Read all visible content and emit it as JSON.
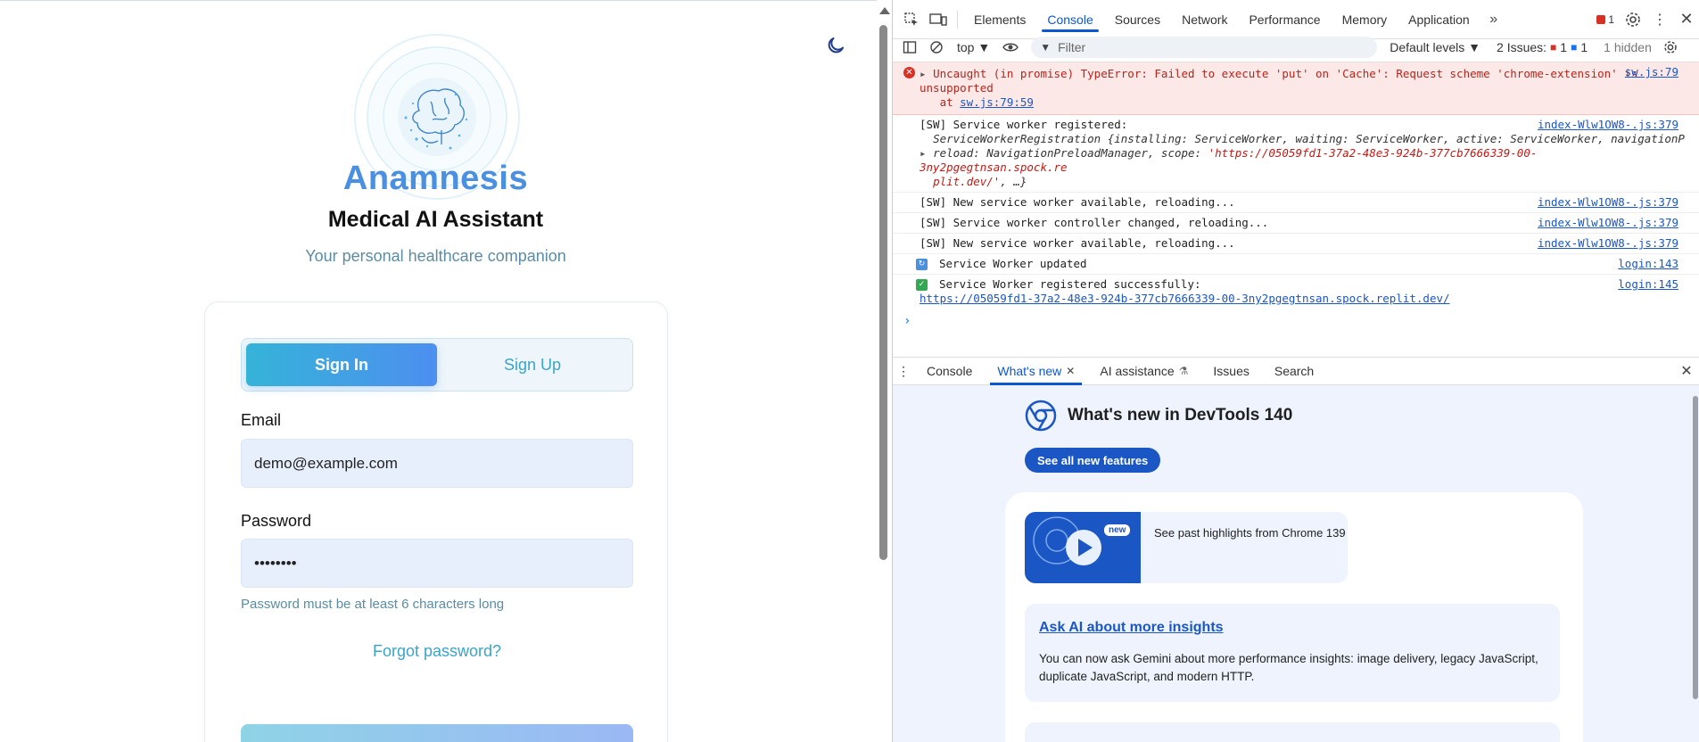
{
  "app": {
    "brand": "Anamnesis",
    "subtitle": "Medical AI Assistant",
    "tagline": "Your personal healthcare companion",
    "tabs": {
      "signin": "Sign In",
      "signup": "Sign Up"
    },
    "email_label": "Email",
    "email_value": "demo@example.com",
    "password_label": "Password",
    "password_value": "••••••••",
    "password_hint": "Password must be at least 6 characters long",
    "forgot": "Forgot password?",
    "accent": "#4a8fe0"
  },
  "devtools": {
    "tabs": [
      "Elements",
      "Console",
      "Sources",
      "Network",
      "Performance",
      "Memory",
      "Application"
    ],
    "active_tab": "Console",
    "error_count": "1",
    "context": "top ▼",
    "filter_placeholder": "Filter",
    "levels": "Default levels ▼",
    "issues_label": "2 Issues:",
    "issues_err": "1",
    "issues_info": "1",
    "hidden": "1 hidden",
    "messages": {
      "error_text": "Uncaught (in promise) TypeError: Failed to execute 'put' on 'Cache': Request scheme 'chrome-extension' is unsupported",
      "error_at": "at ",
      "error_at_link": "sw.js:79:59",
      "error_src": "sw.js:79",
      "sw_registered": "[SW] Service worker registered:",
      "sw_reg_src": "index-Wlw1OW8-.js:379",
      "sw_reg_obj_1": "ServiceWorkerRegistration {installing: ServiceWorker, waiting: ServiceWorker, active: ServiceWorker, navigationP",
      "sw_reg_obj_2_key": "reload: NavigationPreloadManager, scope: ",
      "sw_reg_obj_2_str": "'https://05059fd1-37a2-48e3-924b-377cb7666339-00-3ny2pgegtnsan.spock.re",
      "sw_reg_obj_3_str": "plit.dev/'",
      "sw_reg_obj_3_tail": ", …}",
      "sw_new_1": "[SW] New service worker available, reloading...",
      "sw_changed": "[SW] Service worker controller changed, reloading...",
      "sw_new_2": "[SW] New service worker available, reloading...",
      "src_379": "index-Wlw1OW8-.js:379",
      "updated": "Service Worker updated",
      "updated_src": "login:143",
      "success": "Service Worker registered successfully:",
      "success_src": "login:145",
      "success_url": "https://05059fd1-37a2-48e3-924b-377cb7666339-00-3ny2pgegtnsan.spock.replit.dev/"
    },
    "drawer_tabs": [
      "Console",
      "What's new",
      "AI assistance",
      "Issues",
      "Search"
    ],
    "whatsnew": {
      "title": "What's new in DevTools 140",
      "button": "See all new features",
      "highlight": "See past highlights from Chrome 139",
      "badge": "new",
      "ai_title": "Ask AI about more insights",
      "ai_body": "You can now ask Gemini about more performance insights: image delivery, legacy JavaScript, duplicate JavaScript, and modern HTTP."
    }
  }
}
